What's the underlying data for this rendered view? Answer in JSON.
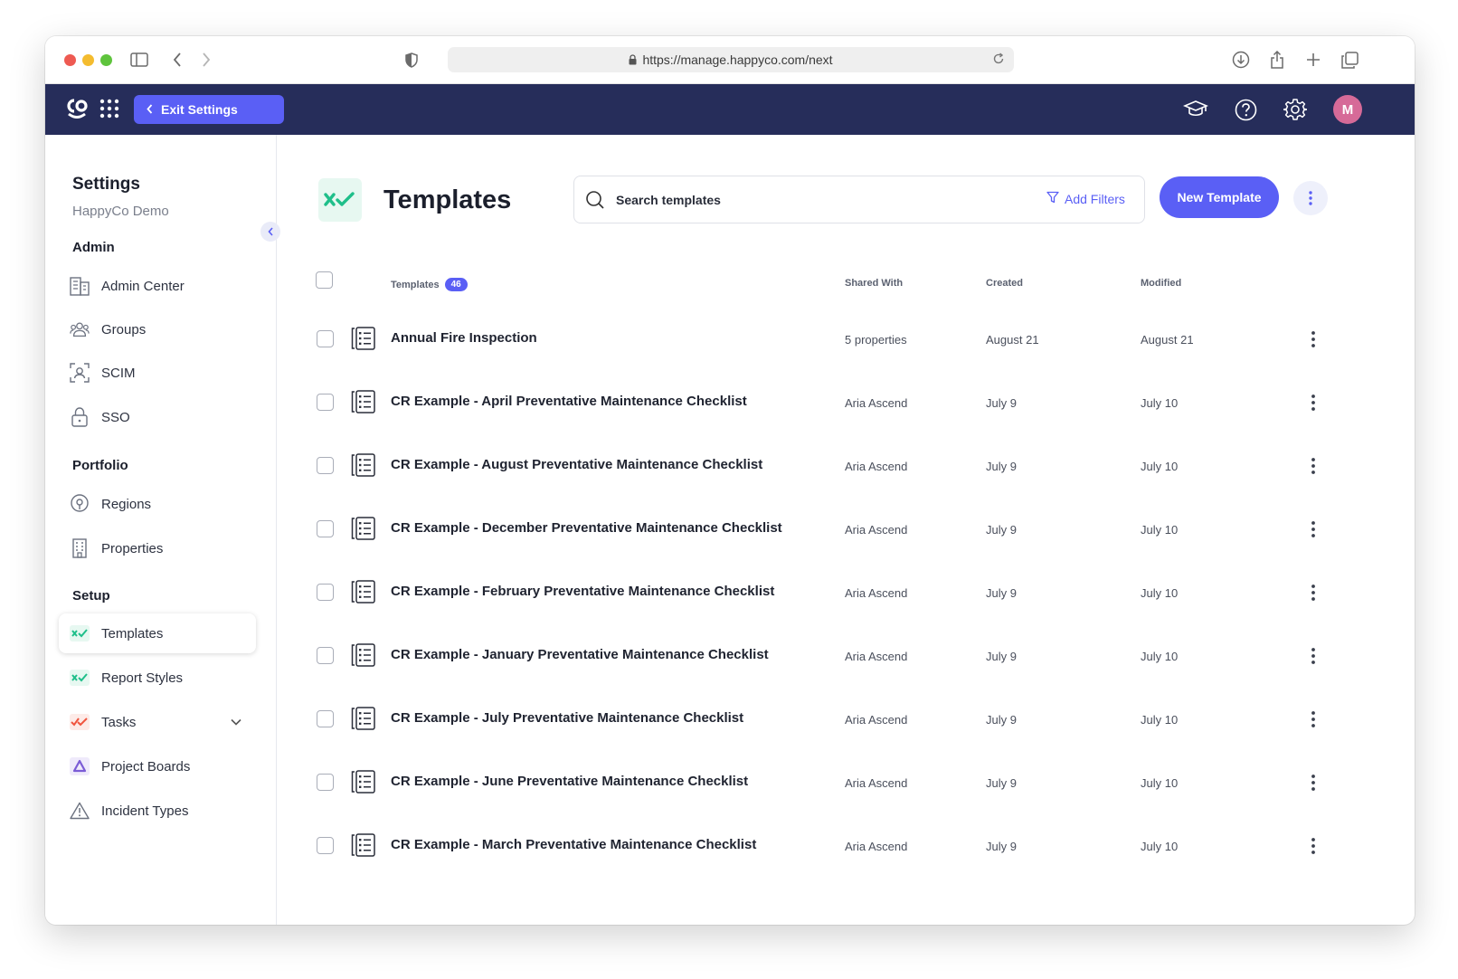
{
  "browser": {
    "url": "https://manage.happyco.com/next"
  },
  "header": {
    "exit_settings_label": "Exit Settings",
    "avatar_initial": "M"
  },
  "sidebar": {
    "title": "Settings",
    "subtitle": "HappyCo Demo",
    "sections": {
      "admin": "Admin",
      "portfolio": "Portfolio",
      "setup": "Setup"
    },
    "items": {
      "admin_center": "Admin Center",
      "groups": "Groups",
      "scim": "SCIM",
      "sso": "SSO",
      "regions": "Regions",
      "properties": "Properties",
      "templates": "Templates",
      "report_styles": "Report Styles",
      "tasks": "Tasks",
      "project_boards": "Project Boards",
      "incident_types": "Incident Types"
    }
  },
  "main": {
    "title": "Templates",
    "search": {
      "placeholder": "Search templates",
      "value": ""
    },
    "add_filters_label": "Add Filters",
    "new_template_label": "New Template"
  },
  "table": {
    "headers": {
      "templates": "Templates",
      "count": "46",
      "shared_with": "Shared With",
      "created": "Created",
      "modified": "Modified"
    },
    "rows": [
      {
        "name": "Annual Fire Inspection",
        "shared": "5 properties",
        "created": "August 21",
        "modified": "August 21"
      },
      {
        "name": "CR Example - April Preventative Maintenance Checklist",
        "shared": "Aria Ascend",
        "created": "July 9",
        "modified": "July 10"
      },
      {
        "name": "CR Example - August Preventative Maintenance Checklist",
        "shared": "Aria Ascend",
        "created": "July 9",
        "modified": "July 10"
      },
      {
        "name": "CR Example - December Preventative Maintenance Checklist",
        "shared": "Aria Ascend",
        "created": "July 9",
        "modified": "July 10"
      },
      {
        "name": "CR Example - February Preventative Maintenance Checklist",
        "shared": "Aria Ascend",
        "created": "July 9",
        "modified": "July 10"
      },
      {
        "name": "CR Example - January Preventative Maintenance Checklist",
        "shared": "Aria Ascend",
        "created": "July 9",
        "modified": "July 10"
      },
      {
        "name": "CR Example - July Preventative Maintenance Checklist",
        "shared": "Aria Ascend",
        "created": "July 9",
        "modified": "July 10"
      },
      {
        "name": "CR Example - June Preventative Maintenance Checklist",
        "shared": "Aria Ascend",
        "created": "July 9",
        "modified": "July 10"
      },
      {
        "name": "CR Example - March Preventative Maintenance Checklist",
        "shared": "Aria Ascend",
        "created": "July 9",
        "modified": "July 10"
      }
    ]
  },
  "colors": {
    "accent": "#5a5ff5",
    "header_bg": "#262d5a",
    "template_green": "#1fbf8a",
    "tasks_red": "#f0553f",
    "project_purple": "#7b5cd6"
  }
}
